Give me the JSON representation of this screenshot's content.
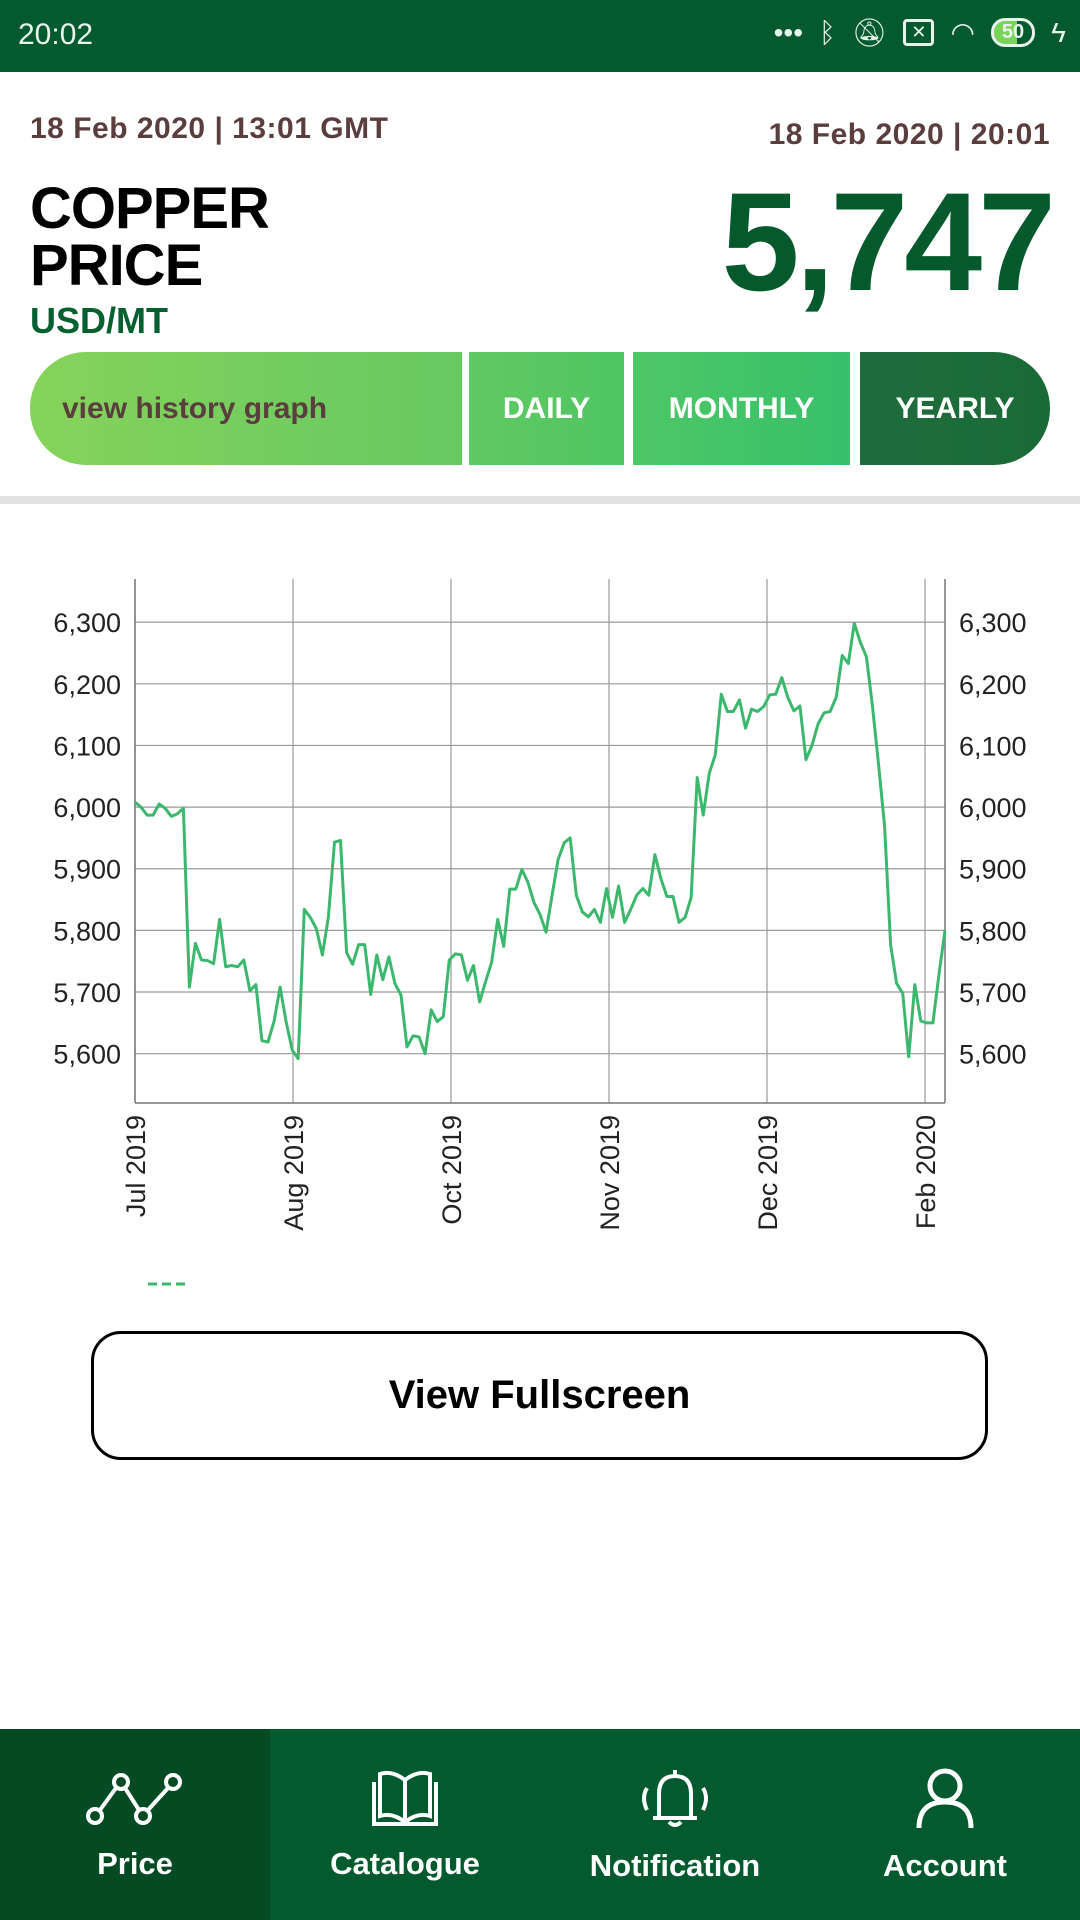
{
  "status_bar": {
    "time": "20:02",
    "battery": "50",
    "icons": [
      "more-dots-icon",
      "bluetooth-icon",
      "bell-off-icon",
      "sim-x-icon",
      "wifi-icon",
      "battery-icon",
      "charging-icon"
    ]
  },
  "header": {
    "market_date": "18 Feb 2020 | 13:01 GMT",
    "local_date": "18 Feb 2020 | 20:01",
    "title_line1": "COPPER",
    "title_line2": "PRICE",
    "unit": "USD/MT",
    "price": "5,747"
  },
  "segments": {
    "label": "view history graph",
    "options": [
      "DAILY",
      "MONTHLY",
      "YEARLY"
    ],
    "selected": "YEARLY"
  },
  "colors": {
    "brand": "#035a2e",
    "line": "#3cb86e",
    "price": "#045a2c"
  },
  "chart_data": {
    "type": "line",
    "x_tick_labels": [
      "Jul 2019",
      "Aug 2019",
      "Oct 2019",
      "Nov 2019",
      "Dec 2019",
      "Feb 2020"
    ],
    "y_ticks": [
      5600,
      5700,
      5800,
      5900,
      6000,
      6100,
      6200,
      6300
    ],
    "y_tick_labels": [
      "5,600",
      "5,700",
      "5,800",
      "5,900",
      "6,000",
      "6,100",
      "6,200",
      "6,300"
    ],
    "ylim": [
      5520,
      6370
    ],
    "grid": true,
    "y_axis_both_sides": true,
    "legend": {
      "placement": "bottom-left",
      "entries": [
        {
          "name": ""
        }
      ]
    },
    "series": [
      {
        "values": [
          6008,
          6000,
          5987,
          5987,
          6005,
          5998,
          5985,
          5989,
          5998,
          5708,
          5779,
          5752,
          5751,
          5746,
          5818,
          5741,
          5743,
          5741,
          5752,
          5702,
          5712,
          5621,
          5619,
          5652,
          5708,
          5652,
          5606,
          5592,
          5834,
          5821,
          5803,
          5760,
          5822,
          5943,
          5946,
          5764,
          5745,
          5777,
          5777,
          5696,
          5760,
          5720,
          5757,
          5714,
          5695,
          5611,
          5629,
          5627,
          5600,
          5671,
          5652,
          5660,
          5752,
          5762,
          5760,
          5719,
          5743,
          5684,
          5717,
          5748,
          5818,
          5774,
          5867,
          5867,
          5899,
          5878,
          5845,
          5826,
          5797,
          5857,
          5915,
          5942,
          5950,
          5857,
          5830,
          5822,
          5834,
          5813,
          5868,
          5821,
          5872,
          5813,
          5834,
          5857,
          5868,
          5857,
          5923,
          5884,
          5855,
          5855,
          5813,
          5821,
          5853,
          6048,
          5987,
          6055,
          6085,
          6183,
          6155,
          6155,
          6174,
          6128,
          6159,
          6155,
          6163,
          6182,
          6183,
          6210,
          6178,
          6156,
          6164,
          6077,
          6100,
          6135,
          6153,
          6155,
          6178,
          6246,
          6233,
          6298,
          6267,
          6244,
          6163,
          6070,
          5969,
          5777,
          5714,
          5698,
          5595,
          5712,
          5653,
          5650,
          5650,
          5729,
          5800
        ]
      }
    ]
  },
  "fullscreen_button": "View Fullscreen",
  "nav": [
    {
      "label": "Price",
      "icon": "line-chart-icon",
      "active": true
    },
    {
      "label": "Catalogue",
      "icon": "book-icon",
      "active": false
    },
    {
      "label": "Notification",
      "icon": "bell-ringing-icon",
      "active": false
    },
    {
      "label": "Account",
      "icon": "user-icon",
      "active": false
    }
  ]
}
